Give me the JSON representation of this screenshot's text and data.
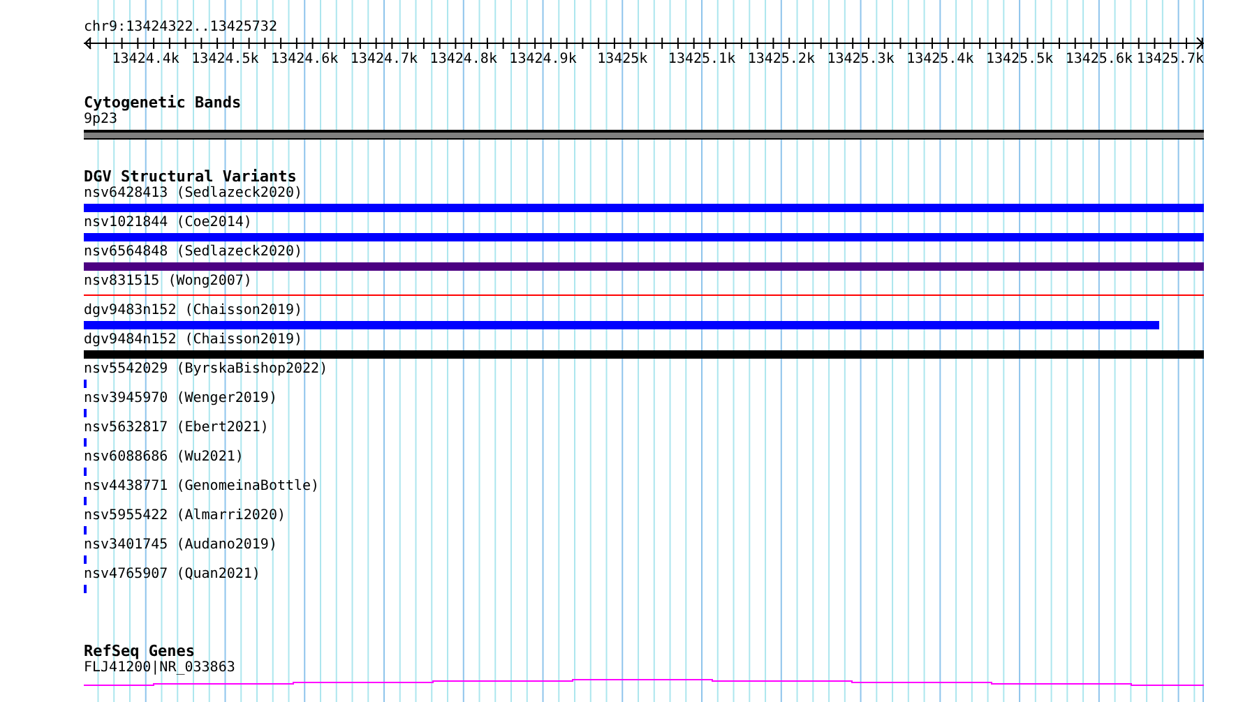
{
  "position": "chr9:13424322..13425732",
  "ruler": {
    "labels": [
      "13424.4k",
      "13424.5k",
      "13424.6k",
      "13424.7k",
      "13424.8k",
      "13424.9k",
      "13425k",
      "13425.1k",
      "13425.2k",
      "13425.3k",
      "13425.4k",
      "13425.5k",
      "13425.6k",
      "13425.7k"
    ]
  },
  "cytogenetic_bands": {
    "title": "Cytogenetic Bands",
    "band": "9p23"
  },
  "dgv_structural_variants": {
    "title": "DGV Structural Variants",
    "variants": [
      {
        "label": "nsv6428413 (Sedlazeck2020)",
        "kind": "bar",
        "color": "#0000ff"
      },
      {
        "label": "nsv1021844 (Coe2014)",
        "kind": "bar",
        "color": "#0000ff"
      },
      {
        "label": "nsv6564848 (Sedlazeck2020)",
        "kind": "bar",
        "color": "#4b0082"
      },
      {
        "label": "nsv831515 (Wong2007)",
        "kind": "line",
        "color": "#ff0000"
      },
      {
        "label": "dgv9483n152 (Chaisson2019)",
        "kind": "short-bar",
        "color": "#0000ff"
      },
      {
        "label": "dgv9484n152 (Chaisson2019)",
        "kind": "bar",
        "color": "#000000"
      },
      {
        "label": "nsv5542029 (ByrskaBishop2022)",
        "kind": "point",
        "color": "#0000ff"
      },
      {
        "label": "nsv3945970 (Wenger2019)",
        "kind": "point",
        "color": "#0000ff"
      },
      {
        "label": "nsv5632817 (Ebert2021)",
        "kind": "point",
        "color": "#0000ff"
      },
      {
        "label": "nsv6088686 (Wu2021)",
        "kind": "point",
        "color": "#0000ff"
      },
      {
        "label": "nsv4438771 (GenomeinaBottle)",
        "kind": "point",
        "color": "#0000ff"
      },
      {
        "label": "nsv5955422 (Almarri2020)",
        "kind": "point",
        "color": "#0000ff"
      },
      {
        "label": "nsv3401745 (Audano2019)",
        "kind": "point",
        "color": "#0000ff"
      },
      {
        "label": "nsv4765907 (Quan2021)",
        "kind": "point",
        "color": "#0000ff"
      }
    ]
  },
  "refseq_genes": {
    "title": "RefSeq Genes",
    "gene": "FLJ41200|NR_033863"
  }
}
